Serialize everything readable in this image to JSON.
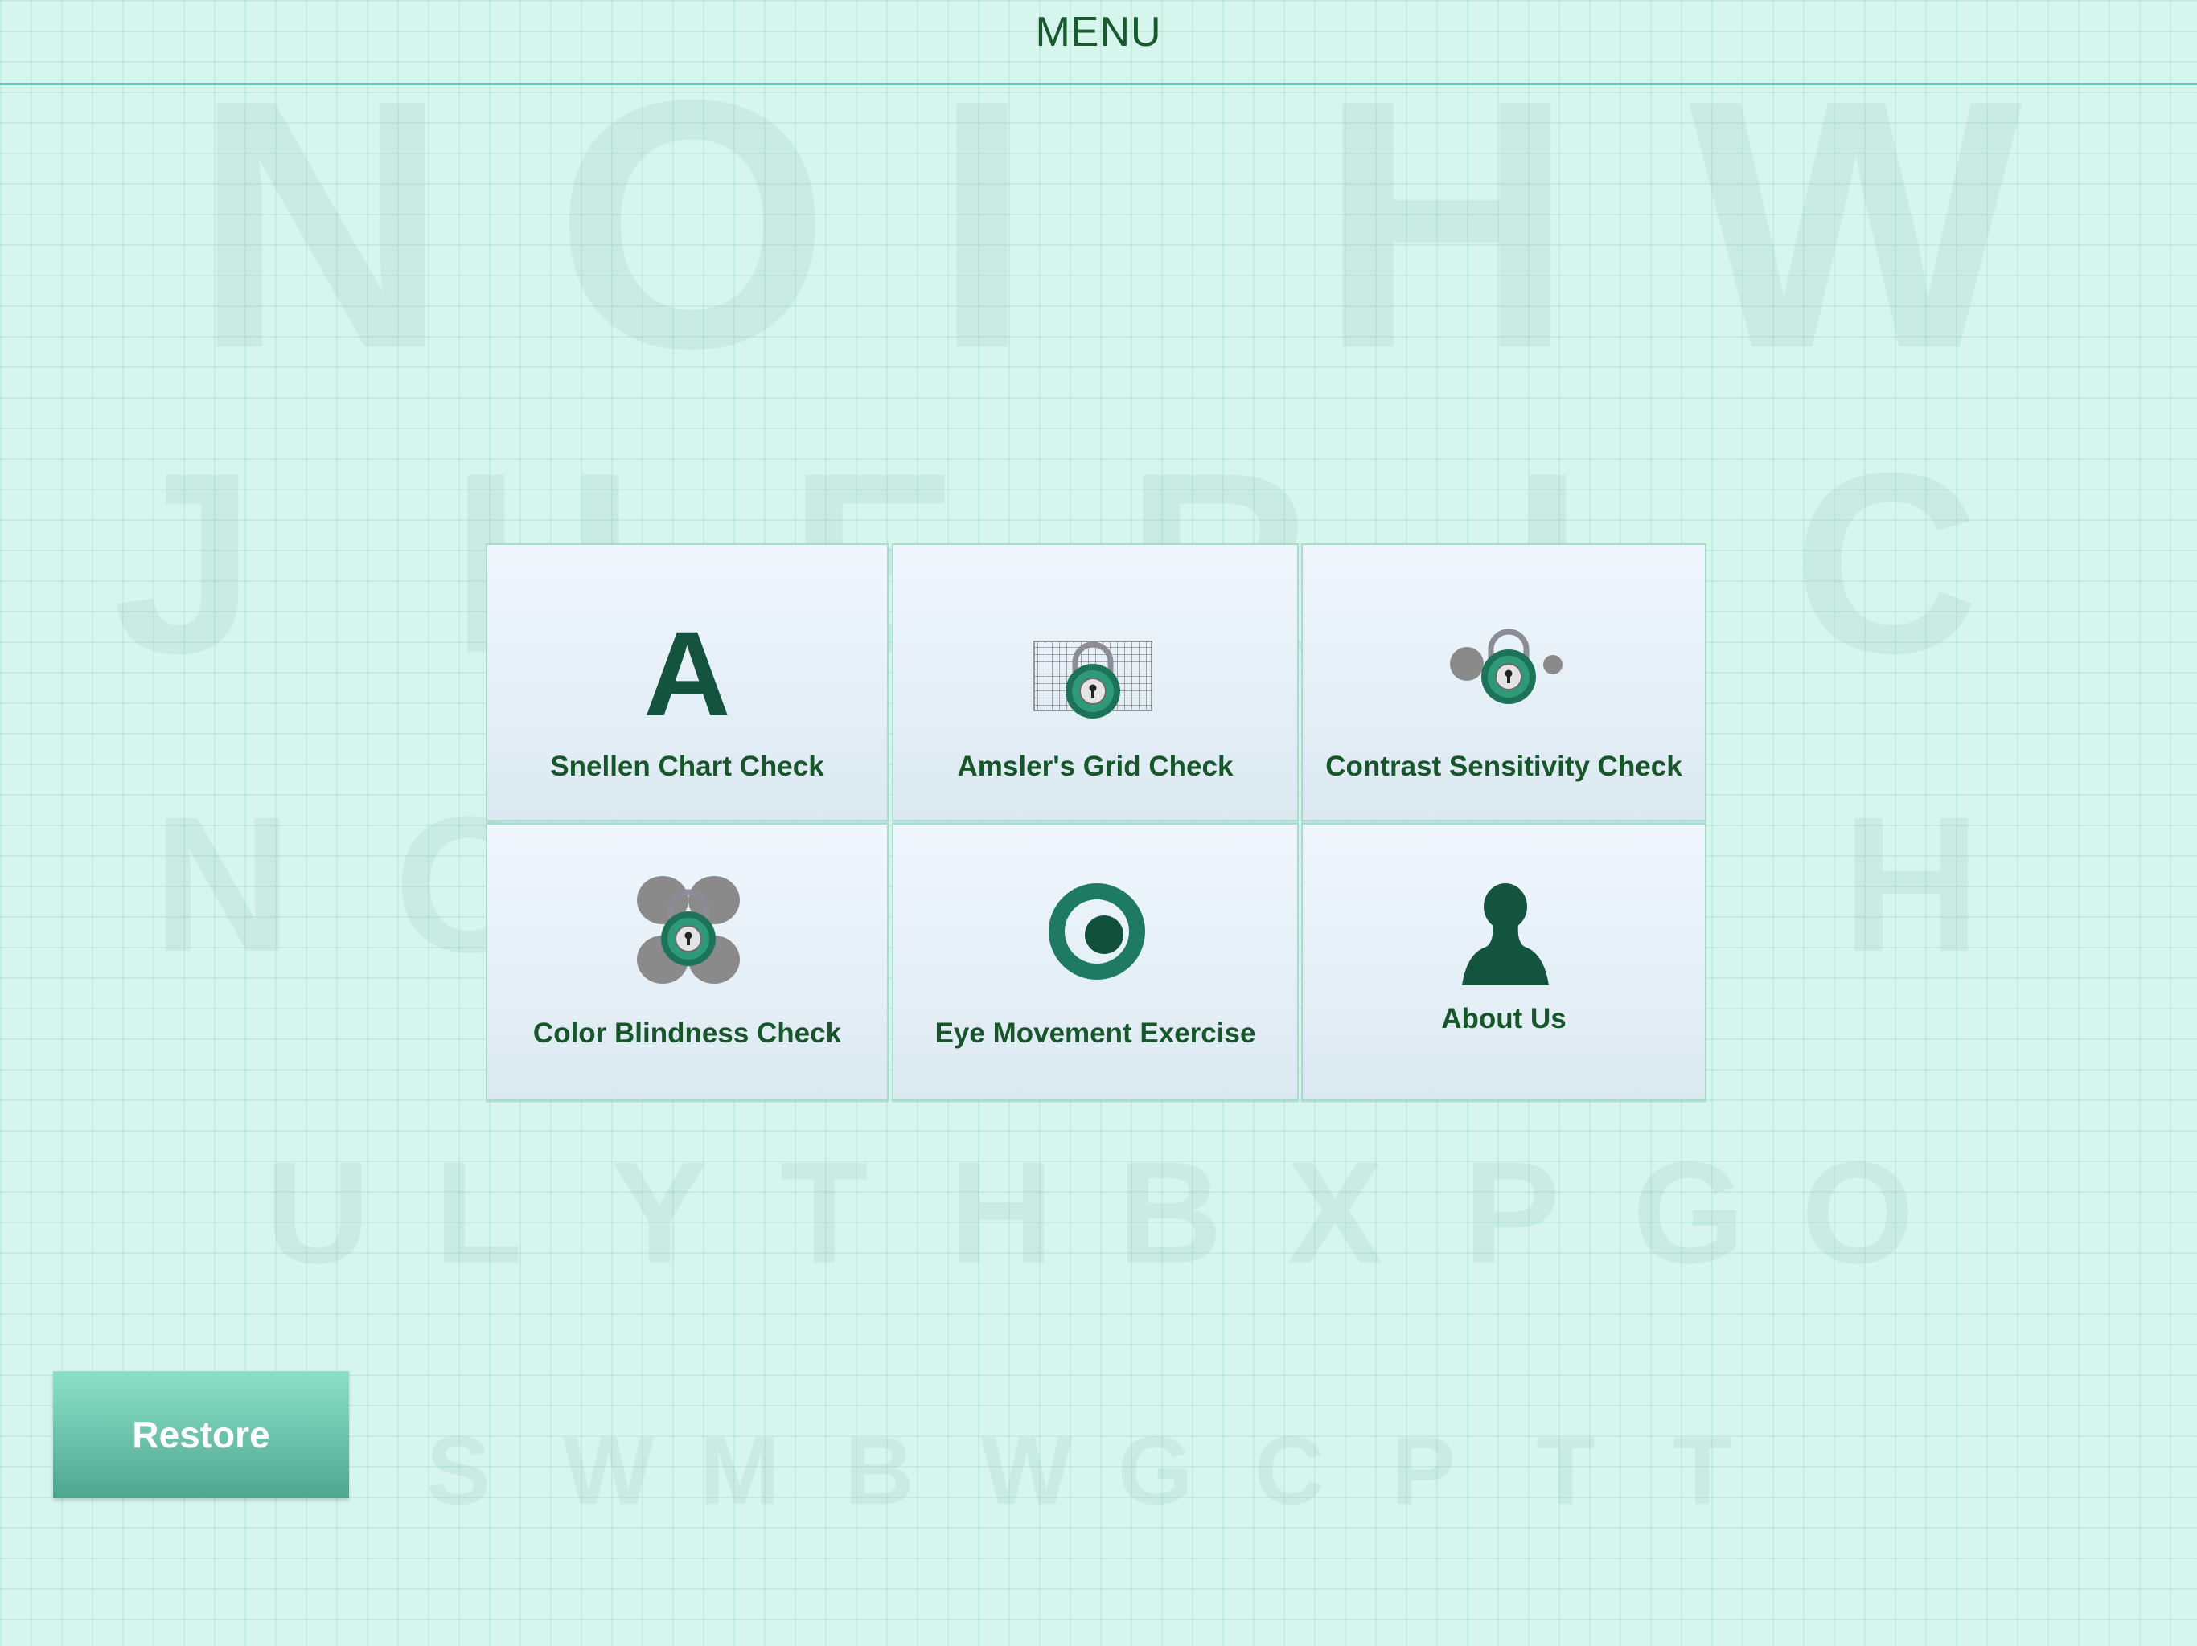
{
  "header": {
    "title": "MENU"
  },
  "background_chart": {
    "row1": [
      "N",
      "O",
      "I",
      "H",
      "W"
    ],
    "row2": [
      "J",
      "H",
      "E",
      "R",
      "I",
      "C"
    ],
    "row3": [
      "N",
      "O",
      "",
      "",
      "",
      "",
      "",
      "H"
    ],
    "row4": [
      "U",
      "L",
      "Y",
      "T",
      "H",
      "B",
      "X",
      "P",
      "G",
      "O"
    ],
    "row5": [
      "S",
      "W",
      "M",
      "B",
      "W",
      "G",
      "C",
      "P",
      "T",
      "T"
    ]
  },
  "menu": {
    "items": [
      {
        "label": "Snellen Chart Check",
        "icon": "letter-a-icon",
        "glyph": "A",
        "locked": false
      },
      {
        "label": "Amsler's Grid Check",
        "icon": "grid-lock-icon",
        "locked": true
      },
      {
        "label": "Contrast Sensitivity Check",
        "icon": "contrast-lock-icon",
        "locked": true
      },
      {
        "label": "Color Blindness Check",
        "icon": "color-lock-icon",
        "locked": true
      },
      {
        "label": "Eye Movement Exercise",
        "icon": "eye-ring-icon",
        "locked": false
      },
      {
        "label": "About Us",
        "icon": "person-icon",
        "locked": false
      }
    ]
  },
  "restore": {
    "label": "Restore"
  },
  "colors": {
    "accent": "#16562a",
    "icon": "#1f7a63",
    "tile_border": "#a8dccf",
    "background": "#d6f5ec"
  }
}
